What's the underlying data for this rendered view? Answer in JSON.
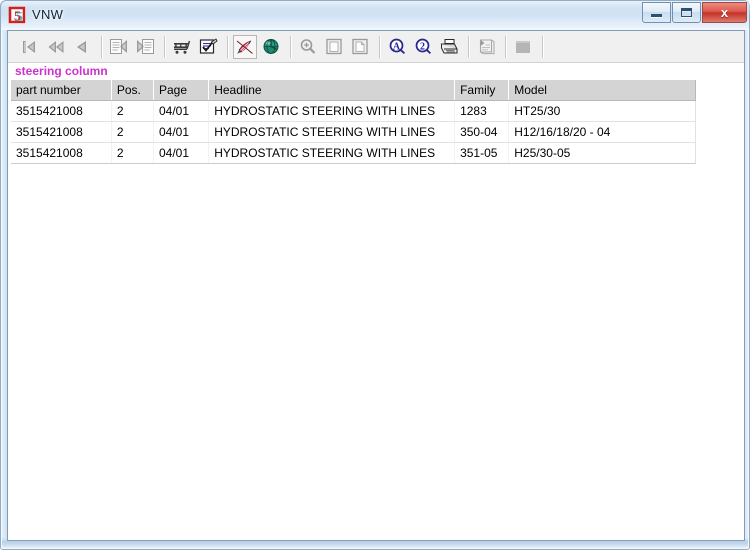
{
  "window": {
    "title": "VNW",
    "app_icon": "app-logo-icon",
    "controls": {
      "minimize": "minimize-icon",
      "maximize": "maximize-icon",
      "close_label": "x"
    }
  },
  "toolbar": {
    "buttons": [
      {
        "name": "first-record-button",
        "icon": "skip-to-start-icon",
        "enabled": false,
        "active": false
      },
      {
        "name": "fast-rewind-button",
        "icon": "rewind-icon",
        "enabled": false,
        "active": false
      },
      {
        "name": "previous-record-button",
        "icon": "play-back-icon",
        "enabled": false,
        "active": false
      },
      {
        "name": "separator-1",
        "icon": "separator",
        "enabled": false,
        "active": false
      },
      {
        "name": "previous-document-button",
        "icon": "document-previous-icon",
        "enabled": false,
        "active": false
      },
      {
        "name": "next-document-button",
        "icon": "document-next-icon",
        "enabled": false,
        "active": false
      },
      {
        "name": "separator-2",
        "icon": "separator",
        "enabled": false,
        "active": false
      },
      {
        "name": "shopping-cart-button",
        "icon": "shopping-cart-icon",
        "enabled": true,
        "active": false
      },
      {
        "name": "order-list-button",
        "icon": "checklist-document-icon",
        "enabled": true,
        "active": false
      },
      {
        "name": "separator-3",
        "icon": "separator",
        "enabled": false,
        "active": false
      },
      {
        "name": "annotate-button",
        "icon": "pen-nib-icon",
        "enabled": true,
        "active": true
      },
      {
        "name": "globe-button",
        "icon": "globe-icon",
        "enabled": true,
        "active": false
      },
      {
        "name": "separator-4",
        "icon": "separator",
        "enabled": false,
        "active": false
      },
      {
        "name": "zoom-button",
        "icon": "magnifier-plus-icon",
        "enabled": false,
        "active": false
      },
      {
        "name": "page-view-button",
        "icon": "page-icon",
        "enabled": false,
        "active": false
      },
      {
        "name": "page-alt-view-button",
        "icon": "page-corner-icon",
        "enabled": false,
        "active": false
      },
      {
        "name": "separator-5",
        "icon": "separator",
        "enabled": false,
        "active": false
      },
      {
        "name": "find-text-button",
        "icon": "circled-a-search-icon",
        "enabled": true,
        "active": false
      },
      {
        "name": "find-number-button",
        "icon": "circled-2-search-icon",
        "enabled": true,
        "active": false
      },
      {
        "name": "print-button",
        "icon": "printer-icon",
        "enabled": true,
        "active": false
      },
      {
        "name": "separator-6",
        "icon": "separator",
        "enabled": false,
        "active": false
      },
      {
        "name": "notes-button",
        "icon": "notepad-icon",
        "enabled": false,
        "active": false
      },
      {
        "name": "separator-7",
        "icon": "separator",
        "enabled": false,
        "active": false
      },
      {
        "name": "blank-button",
        "icon": "filled-square-icon",
        "enabled": false,
        "active": false
      }
    ]
  },
  "results": {
    "title": "steering column",
    "columns": [
      "part number",
      "Pos.",
      "Page",
      "Headline",
      "Family",
      "Model"
    ],
    "rows": [
      {
        "part_number": "3515421008",
        "pos": "2",
        "page": "04/01",
        "headline": "HYDROSTATIC STEERING WITH LINES",
        "family": "1283",
        "model": "HT25/30"
      },
      {
        "part_number": "3515421008",
        "pos": "2",
        "page": "04/01",
        "headline": "HYDROSTATIC STEERING WITH LINES",
        "family": "350-04",
        "model": "H12/16/18/20 - 04"
      },
      {
        "part_number": "3515421008",
        "pos": "2",
        "page": "04/01",
        "headline": "HYDROSTATIC STEERING WITH LINES",
        "family": "351-05",
        "model": "H25/30-05"
      }
    ]
  },
  "colors": {
    "result_title": "#cc33cc",
    "link_text": "#3333cc",
    "header_background": "#d4d4d4",
    "close_button": "#c33226"
  }
}
